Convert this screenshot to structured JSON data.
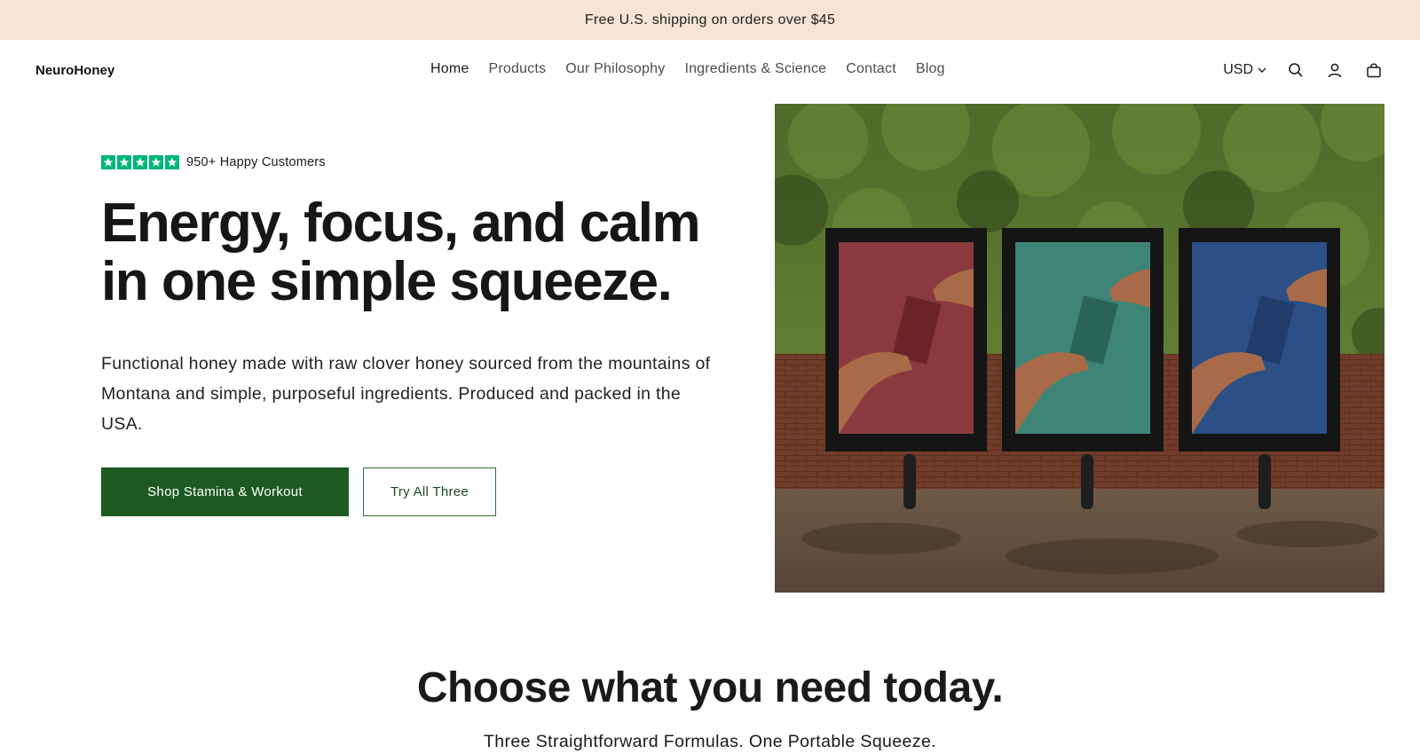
{
  "announcement": {
    "text": "Free U.S. shipping on orders over $45"
  },
  "header": {
    "logo": "NeuroHoney",
    "nav": [
      {
        "label": "Home",
        "active": true
      },
      {
        "label": "Products"
      },
      {
        "label": "Our Philosophy"
      },
      {
        "label": "Ingredients & Science"
      },
      {
        "label": "Contact"
      },
      {
        "label": "Blog"
      }
    ],
    "currency": "USD",
    "icons": [
      "search-icon",
      "account-icon",
      "cart-icon"
    ]
  },
  "hero": {
    "rating_stars": 5,
    "rating_text": "950+ Happy Customers",
    "headline": "Energy, focus, and calm in one simple squeeze.",
    "body": "Functional honey made with raw clover honey sourced from the mountains of Montana and simple, purposeful ingredients. Produced and packed in the USA.",
    "primary_cta": "Shop Stamina & Workout",
    "secondary_cta": "Try All Three"
  },
  "section": {
    "title": "Choose what you need today.",
    "subtitle": "Three Straightforward Formulas. One Portable Squeeze."
  },
  "colors": {
    "announcement_bg": "#f6e4d6",
    "primary_green": "#1c5a20",
    "star_green": "#00b67a",
    "panel_red": "#8a3a3e",
    "panel_teal": "#3e8578",
    "panel_blue": "#2c4f86"
  }
}
